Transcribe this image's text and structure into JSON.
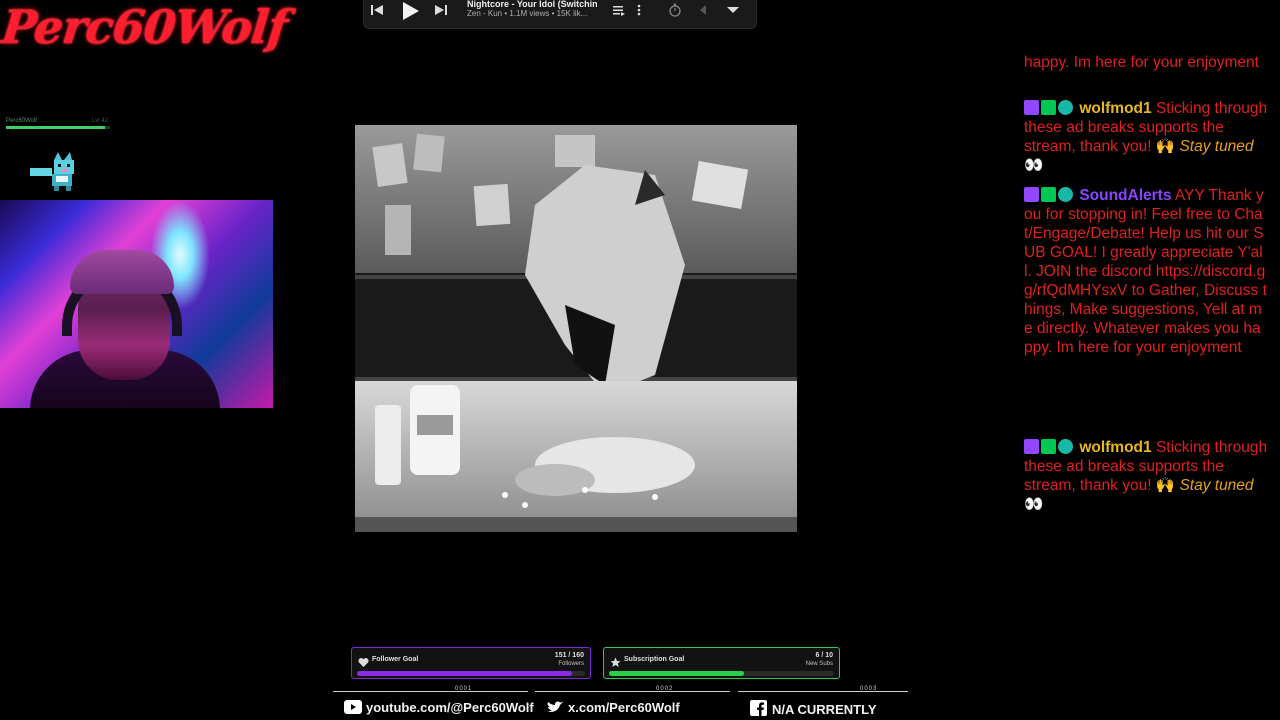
{
  "logo": {
    "text": "Perc60Wolf"
  },
  "mini_status": {
    "name": "Perc60Wolf",
    "level": "Lvl 42",
    "progress": 0.95
  },
  "pet_icon": "pixel-wolf-icon",
  "media": {
    "title": "Nightcore - Your Idol (Switchin...",
    "subtitle": "Zen - Kun • 1.1M views • 15K lik...",
    "icons": [
      "previous-icon",
      "play-icon",
      "next-icon",
      "playlist-icon",
      "more-icon",
      "timer-icon",
      "back-icon",
      "dropdown-icon"
    ]
  },
  "chat": {
    "messages": [
      {
        "user": "",
        "text": "happy. Im here for your enjoyment",
        "partial": true
      },
      {
        "user": "wolfmod1",
        "text": "Sticking through these ad breaks supports the stream, thank you! 🙌",
        "emote": "Stay tuned",
        "tail": "👀"
      },
      {
        "user": "SoundAlerts",
        "text": "AYY Thank you for stopping in! Feel free to Chat/Engage/Debate! Help us hit our SUB GOAL! I greatly appreciate Y'all. JOIN the discord https://discord.gg/rfQdMHYsxV to Gather, Discuss things, Make suggestions, Yell at me directly. Whatever makes you happy. Im here for your enjoyment"
      },
      {
        "user": "wolfmod1",
        "text": "Sticking through these ad breaks supports the stream, thank you! 🙌",
        "emote": "Stay tuned",
        "tail": "👀"
      }
    ]
  },
  "goals": {
    "follower": {
      "title": "Follower Goal",
      "count": "151 / 160",
      "unit": "Followers",
      "progress": 0.944,
      "color": "#8a2be2"
    },
    "subscription": {
      "title": "Subscription Goal",
      "count": "6 / 10",
      "unit": "New Subs",
      "progress": 0.6,
      "color": "#2ad04a"
    }
  },
  "social": {
    "youtube": "youtube.com/@Perc60Wolf",
    "twitter": "x.com/Perc60Wolf",
    "facebook": "N/A CURRENTLY",
    "segments": [
      "0001",
      "0002",
      "0003"
    ]
  },
  "colors": {
    "chat_text": "#e0201e",
    "mod_name": "#e8b81e",
    "alerts_name": "#8b45ff"
  }
}
